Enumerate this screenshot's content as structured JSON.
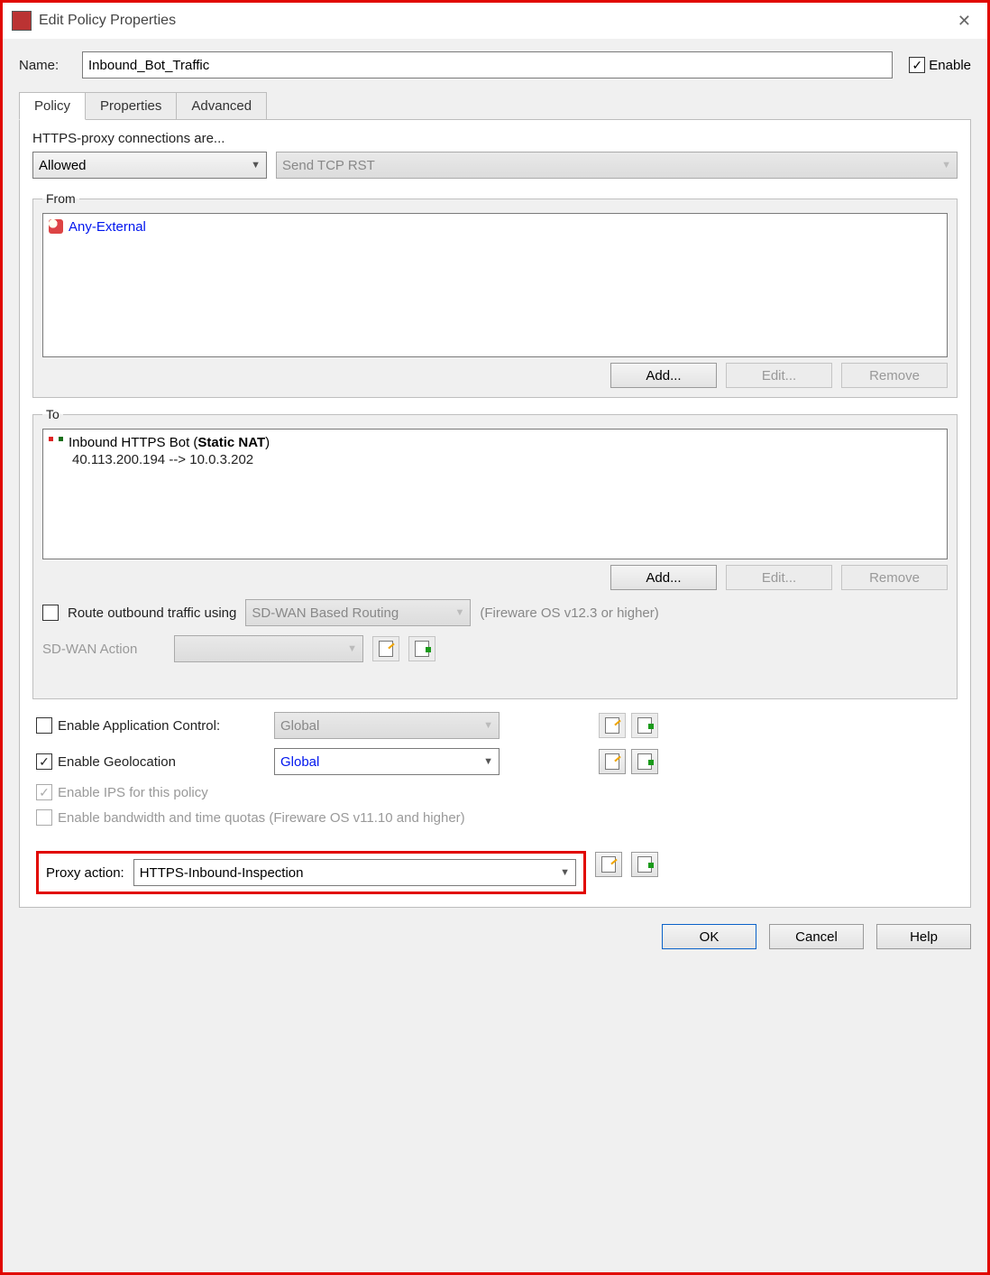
{
  "window": {
    "title": "Edit Policy Properties"
  },
  "name": {
    "label": "Name:",
    "value": "Inbound_Bot_Traffic"
  },
  "enable": {
    "label": "Enable",
    "checked": true
  },
  "tabs": [
    {
      "label": "Policy",
      "active": true
    },
    {
      "label": "Properties",
      "active": false
    },
    {
      "label": "Advanced",
      "active": false
    }
  ],
  "connections": {
    "label": "HTTPS-proxy connections are...",
    "action": "Allowed",
    "reset_action": "Send TCP RST"
  },
  "from": {
    "legend": "From",
    "items": [
      {
        "text": "Any-External",
        "link": true
      }
    ],
    "buttons": {
      "add": "Add...",
      "edit": "Edit...",
      "remove": "Remove"
    }
  },
  "to": {
    "legend": "To",
    "items": [
      {
        "name": "Inbound HTTPS Bot",
        "type": "Static NAT",
        "mapping": "40.113.200.194 --> 10.0.3.202"
      }
    ],
    "buttons": {
      "add": "Add...",
      "edit": "Edit...",
      "remove": "Remove"
    },
    "route_outbound": {
      "label": "Route outbound traffic using",
      "mode": "SD-WAN Based Routing",
      "note": "(Fireware OS v12.3 or higher)",
      "checked": false
    },
    "sdwan_action_label": "SD-WAN Action"
  },
  "options": {
    "app_control": {
      "label": "Enable Application Control:",
      "checked": false,
      "value": "Global"
    },
    "geolocation": {
      "label": "Enable Geolocation",
      "checked": true,
      "value": "Global"
    },
    "ips": {
      "label": "Enable IPS for this policy",
      "checked": true,
      "disabled": true
    },
    "quotas": {
      "label": "Enable bandwidth and time quotas (Fireware OS v11.10 and higher)",
      "disabled": true
    }
  },
  "proxy": {
    "label": "Proxy action:",
    "value": "HTTPS-Inbound-Inspection"
  },
  "footer": {
    "ok": "OK",
    "cancel": "Cancel",
    "help": "Help"
  }
}
